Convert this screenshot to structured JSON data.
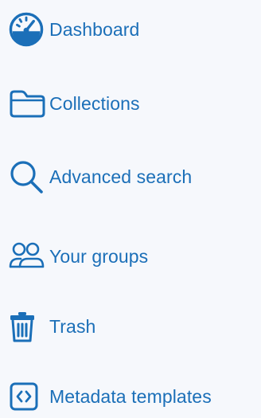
{
  "colors": {
    "accent": "#1b6fb8",
    "background": "#f6f8fc"
  },
  "sidebar": {
    "items": [
      {
        "label": "Dashboard",
        "icon": "speedometer-icon"
      },
      {
        "label": "Collections",
        "icon": "folder-icon"
      },
      {
        "label": "Advanced search",
        "icon": "search-icon"
      },
      {
        "label": "Your groups",
        "icon": "people-icon"
      },
      {
        "label": "Trash",
        "icon": "trash-icon"
      },
      {
        "label": "Metadata templates",
        "icon": "code-square-icon"
      }
    ]
  }
}
